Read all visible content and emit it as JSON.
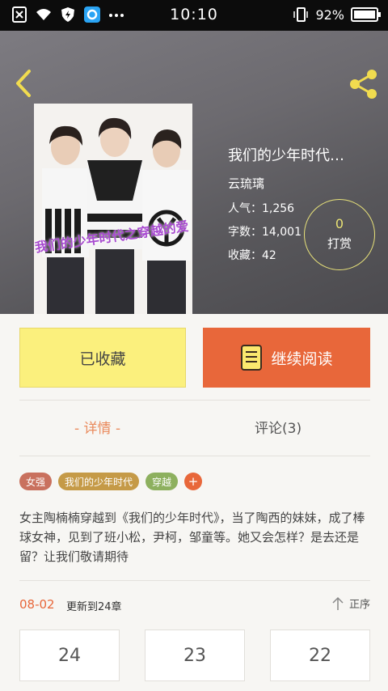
{
  "status_bar": {
    "time": "10:10",
    "battery": "92%"
  },
  "colors": {
    "accent": "#e8673a",
    "favorite": "#fbf07d",
    "tag_1": "#c9715e",
    "tag_2": "#c59a47",
    "tag_3": "#8db05e"
  },
  "book": {
    "title": "我们的少年时代…",
    "author": "云琉璃",
    "popularity": "人气：1,256",
    "word_count": "字数：14,001",
    "favorites": "收藏：42",
    "cover_text": "我们的少年时代之穿越的爱"
  },
  "reward": {
    "count": "0",
    "label": "打赏"
  },
  "actions": {
    "favorited_label": "已收藏",
    "continue_label": "继续阅读"
  },
  "tabs": {
    "detail": "- 详情 -",
    "comments": "评论(3)"
  },
  "tags": [
    "女强",
    "我们的少年时代",
    "穿越"
  ],
  "synopsis": "女主陶楠楠穿越到《我们的少年时代》，当了陶西的妹妹，成了棒球女神，见到了班小松，尹柯，邹童等。她又会怎样？是去还是留？让我们敬请期待",
  "update": {
    "date": "08-02",
    "text": "更新到24章",
    "sort_label": "正序"
  },
  "chapters": [
    "24",
    "23",
    "22"
  ],
  "icons": [
    "close-notification-icon",
    "wifi-icon",
    "shield-icon",
    "app-icon",
    "more-dots-icon",
    "vibrate-icon",
    "battery-icon",
    "back-arrow-icon",
    "share-icon",
    "book-icon",
    "sort-arrow-icon",
    "add-tag-icon"
  ]
}
